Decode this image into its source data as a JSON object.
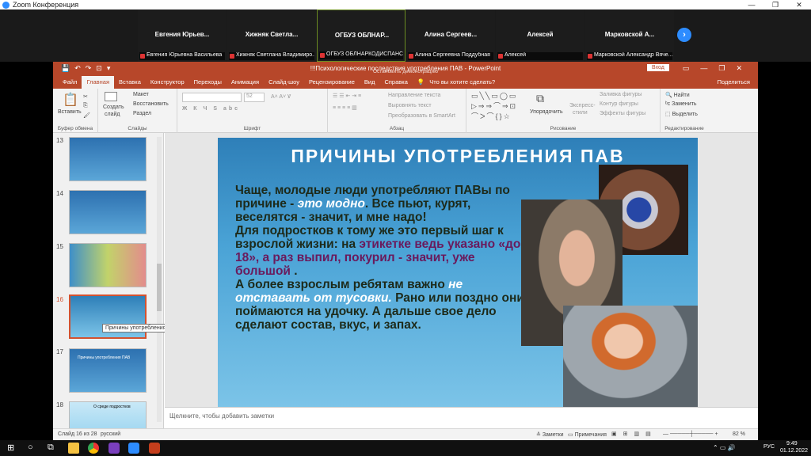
{
  "zoom": {
    "title": "Zoom Конференция",
    "participants": [
      {
        "name": "Евгения Юрьев...",
        "label": "Евгения Юрьевна Васильева"
      },
      {
        "name": "Хижняк Светла...",
        "label": "Хижняк Светлана Владимиро..."
      },
      {
        "name": "ОГБУЗ ОБЛНАР...",
        "label": "ОГБУЗ ОБЛНАРКОДИСПАНСЕР"
      },
      {
        "name": "Алина Сергеев...",
        "label": "Алина Сергеевна Поддубная"
      },
      {
        "name": "Алексей",
        "label": "Алексей"
      },
      {
        "name": "Марковской А...",
        "label": "Марковской Александр Вяче..."
      }
    ],
    "next_icon": "arrow-right-icon"
  },
  "ppt": {
    "title": "!!!Психологические последствия употребления ПАВ - PowerPoint",
    "title_overlay": "Остановить демонстрацию",
    "login_button": "Вход",
    "tabs": [
      "Файл",
      "Главная",
      "Вставка",
      "Конструктор",
      "Переходы",
      "Анимация",
      "Слайд-шоу",
      "Рецензирование",
      "Вид",
      "Справка"
    ],
    "tell_me": "Что вы хотите сделать?",
    "share": "Поделиться",
    "ribbon": {
      "clipboard": {
        "paste": "Вставить",
        "label": "Буфер обмена"
      },
      "slides": {
        "create": "Создать",
        "create2": "слайд",
        "layout": "Макет",
        "reset": "Восстановить",
        "section": "Раздел",
        "label": "Слайды"
      },
      "font": {
        "size": "52",
        "label": "Шрифт",
        "styles": "Ж К Ч S abc"
      },
      "paragraph": {
        "direction": "Направление текста",
        "align": "Выровнять текст",
        "smartart": "Преобразовать в SmartArt",
        "label": "Абзац"
      },
      "drawing": {
        "arrange": "Упорядочить",
        "express": "Экспресс-",
        "express2": "стили",
        "fill": "Заливка фигуры",
        "outline": "Контур фигуры",
        "effects": "Эффекты фигуры",
        "label": "Рисование"
      },
      "editing": {
        "find": "Найти",
        "replace": "Заменить",
        "select": "Выделить",
        "label": "Редактирование"
      }
    },
    "thumbs": [
      {
        "num": "13"
      },
      {
        "num": "14"
      },
      {
        "num": "15"
      },
      {
        "num": "16"
      },
      {
        "num": "17"
      },
      {
        "num": "18"
      }
    ],
    "thumb_texts": {
      "t17": "Причины употребления ПАВ",
      "t18": "О среде подростков"
    },
    "tooltip": "Причины употребления ПАВ",
    "slide": {
      "title": "ПРИЧИНЫ УПОТРЕБЛЕНИЯ ПАВ",
      "p1a": "Чаще, молодые люди употребляют ПАВы по причине - ",
      "p1b": "это модно",
      "p1c": ". Все пьют, курят, веселятся - значит, и мне надо!",
      "p2a": "Для подростков к тому же  это первый шаг к взрослой жизни: на ",
      "p2b": "этикетке ведь указано «до 18», а раз выпил, покурил - значит, уже большой",
      "p2c": " .",
      "p3a": "А более взрослым ребятам важно ",
      "p3b": "не отставать от тусовки.",
      "p3c": " Рано или поздно они поймаются на удочку. А дальше свое дело сделают  состав, вкус, и запах."
    },
    "notes_placeholder": "Щелкните, чтобы добавить заметки",
    "status": {
      "slide_counter": "Слайд 16 из 28",
      "language": "русский",
      "notes": "Заметки",
      "comments": "Примечания",
      "zoom": "82 %"
    }
  },
  "taskbar": {
    "time": "9:49",
    "date": "01.12.2022",
    "lang": "РУС"
  },
  "colors": {
    "ppt_accent": "#b7472a",
    "zoom_blue": "#2d8cff",
    "slide_bg": "#3b92c8"
  }
}
